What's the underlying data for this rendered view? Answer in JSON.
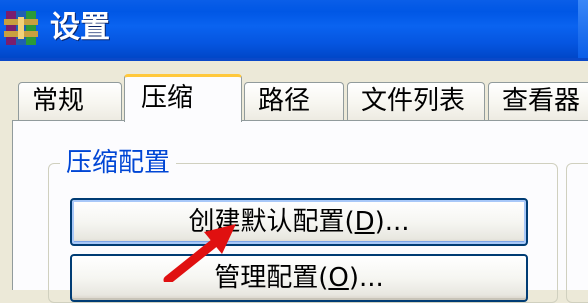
{
  "window": {
    "title": "设置",
    "accent_title_bar": "#0A5EE8",
    "tab_highlight": "#FFC83C"
  },
  "tabs": [
    {
      "label": "常规",
      "active": false
    },
    {
      "label": "压缩",
      "active": true
    },
    {
      "label": "路径",
      "active": false
    },
    {
      "label": "文件列表",
      "active": false
    },
    {
      "label": "查看器",
      "active": false
    }
  ],
  "group": {
    "label": "压缩配置",
    "label_color": "#0046D5"
  },
  "buttons": {
    "create_default_profile": {
      "prefix": "创建默认配置(",
      "accel": "D",
      "suffix": ")..."
    },
    "manage_profiles": {
      "prefix": "管理配置(",
      "accel": "O",
      "suffix": ")..."
    }
  },
  "annotation": {
    "icon": "red-arrow-icon",
    "color": "#E01010"
  }
}
